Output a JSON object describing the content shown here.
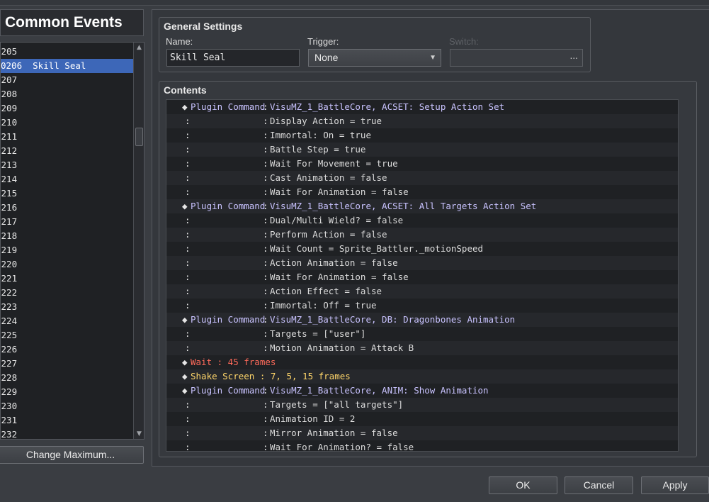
{
  "left_pane": {
    "title": "Common Events",
    "items": [
      {
        "label": "0205"
      },
      {
        "label": "0206  Skill Seal",
        "selected": true
      },
      {
        "label": "0207"
      },
      {
        "label": "0208"
      },
      {
        "label": "0209"
      },
      {
        "label": "0210"
      },
      {
        "label": "0211"
      },
      {
        "label": "0212"
      },
      {
        "label": "0213"
      },
      {
        "label": "0214"
      },
      {
        "label": "0215"
      },
      {
        "label": "0216"
      },
      {
        "label": "0217"
      },
      {
        "label": "0218"
      },
      {
        "label": "0219"
      },
      {
        "label": "0220"
      },
      {
        "label": "0221"
      },
      {
        "label": "0222"
      },
      {
        "label": "0223"
      },
      {
        "label": "0224"
      },
      {
        "label": "0225"
      },
      {
        "label": "0226"
      },
      {
        "label": "0227"
      },
      {
        "label": "0228"
      },
      {
        "label": "0229"
      },
      {
        "label": "0230"
      },
      {
        "label": "0231"
      },
      {
        "label": "0232"
      }
    ],
    "change_max_label": "Change Maximum..."
  },
  "general_settings": {
    "title": "General Settings",
    "name_label": "Name:",
    "name_value": "Skill Seal",
    "trigger_label": "Trigger:",
    "trigger_value": "None",
    "switch_label": "Switch:",
    "switch_button": "..."
  },
  "contents": {
    "title": "Contents",
    "rows": [
      {
        "kind": "plugin",
        "name": "Plugin Command",
        "value": "VisuMZ_1_BattleCore, ACSET: Setup Action Set"
      },
      {
        "kind": "param",
        "value": "Display Action = true"
      },
      {
        "kind": "param",
        "value": "Immortal: On = true"
      },
      {
        "kind": "param",
        "value": "Battle Step = true"
      },
      {
        "kind": "param",
        "value": "Wait For Movement = true"
      },
      {
        "kind": "param",
        "value": "Cast Animation = false"
      },
      {
        "kind": "param",
        "value": "Wait For Animation = false"
      },
      {
        "kind": "plugin",
        "name": "Plugin Command",
        "value": "VisuMZ_1_BattleCore, ACSET: All Targets Action Set"
      },
      {
        "kind": "param",
        "value": "Dual/Multi Wield? = false"
      },
      {
        "kind": "param",
        "value": "Perform Action = false"
      },
      {
        "kind": "param",
        "value": "Wait Count = Sprite_Battler._motionSpeed"
      },
      {
        "kind": "param",
        "value": "Action Animation = false"
      },
      {
        "kind": "param",
        "value": "Wait For Animation = false"
      },
      {
        "kind": "param",
        "value": "Action Effect = false"
      },
      {
        "kind": "param",
        "value": "Immortal: Off = true"
      },
      {
        "kind": "plugin",
        "name": "Plugin Command",
        "value": "VisuMZ_1_BattleCore, DB: Dragonbones Animation"
      },
      {
        "kind": "param",
        "value": "Targets = [\"user\"]"
      },
      {
        "kind": "param",
        "value": "Motion Animation = Attack B"
      },
      {
        "kind": "wait",
        "name": "Wait : 45 frames"
      },
      {
        "kind": "shake",
        "name": "Shake Screen : 7, 5, 15 frames"
      },
      {
        "kind": "plugin",
        "name": "Plugin Command",
        "value": "VisuMZ_1_BattleCore, ANIM: Show Animation"
      },
      {
        "kind": "param",
        "value": "Targets = [\"all targets\"]"
      },
      {
        "kind": "param",
        "value": "Animation ID = 2"
      },
      {
        "kind": "param",
        "value": "Mirror Animation = false"
      },
      {
        "kind": "param",
        "value": "Wait For Animation? = false"
      }
    ]
  },
  "buttons": {
    "ok": "OK",
    "cancel": "Cancel",
    "apply": "Apply"
  },
  "colors": {
    "selection": "#3d67b8",
    "plugin_text": "#c9c3ff",
    "wait_text": "#ff6a5a",
    "shake_text": "#ffd66a"
  }
}
